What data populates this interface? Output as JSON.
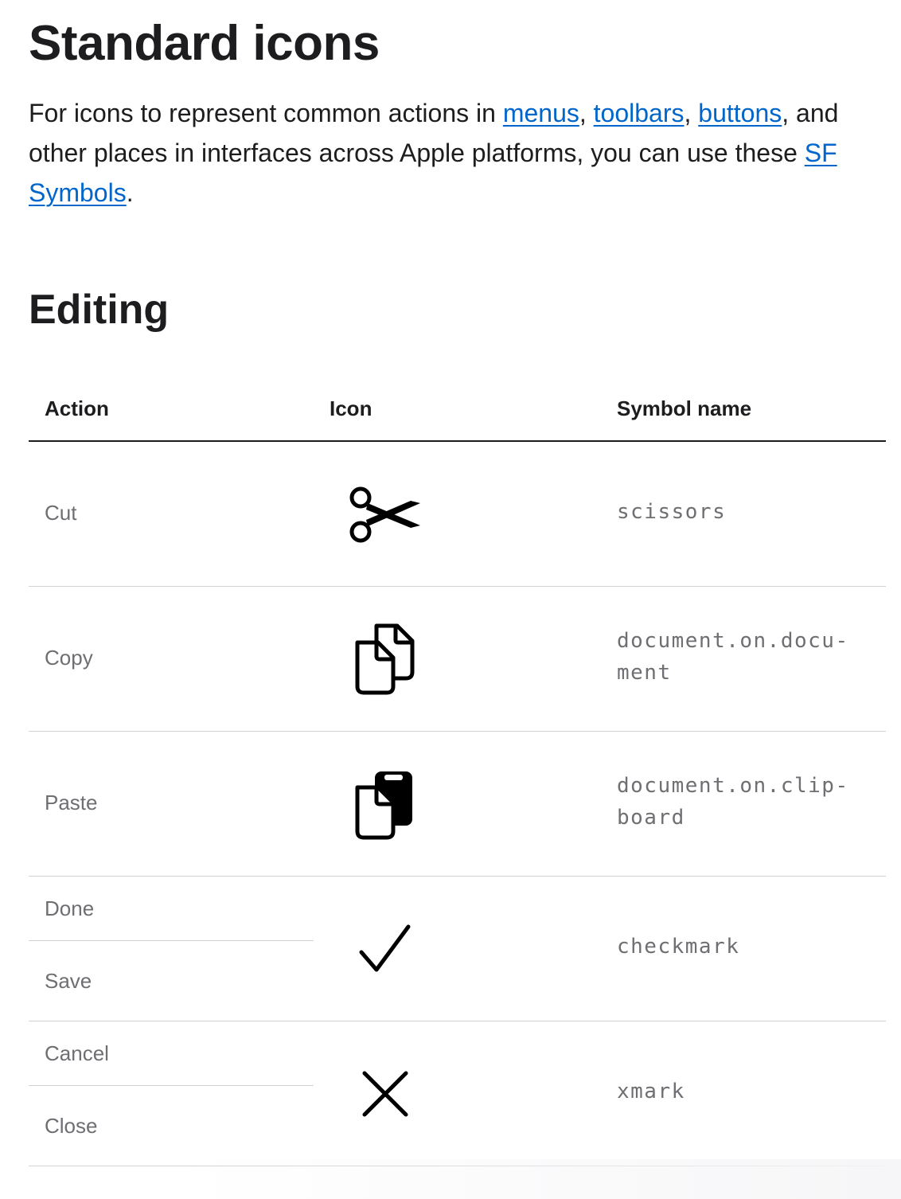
{
  "page": {
    "title": "Standard icons",
    "intro": {
      "before": "For icons to represent common actions in ",
      "link_menus": "menus",
      "sep1": ", ",
      "link_toolbars": "toolbars",
      "sep2": ", ",
      "link_buttons": "buttons",
      "middle": ", and other places in interfaces across Apple platforms, you can use these ",
      "link_sf": "SF Symbols",
      "after": "."
    },
    "link_color": "#0066cc"
  },
  "section": {
    "title": "Editing",
    "headers": {
      "action": "Action",
      "icon": "Icon",
      "symbol": "Symbol name"
    },
    "rows": [
      {
        "actions": [
          "Cut"
        ],
        "icon": "scissors-icon",
        "symbol_lines": [
          "scissors"
        ]
      },
      {
        "actions": [
          "Copy"
        ],
        "icon": "document-on-document-icon",
        "symbol_lines": [
          "document.on.docu-",
          "ment"
        ]
      },
      {
        "actions": [
          "Paste"
        ],
        "icon": "document-on-clipboard-icon",
        "symbol_lines": [
          "document.on.clip-",
          "board"
        ]
      },
      {
        "actions": [
          "Done",
          "Save"
        ],
        "icon": "checkmark-icon",
        "symbol_lines": [
          "checkmark"
        ]
      },
      {
        "actions": [
          "Cancel",
          "Close"
        ],
        "icon": "xmark-icon",
        "symbol_lines": [
          "xmark"
        ]
      }
    ]
  }
}
